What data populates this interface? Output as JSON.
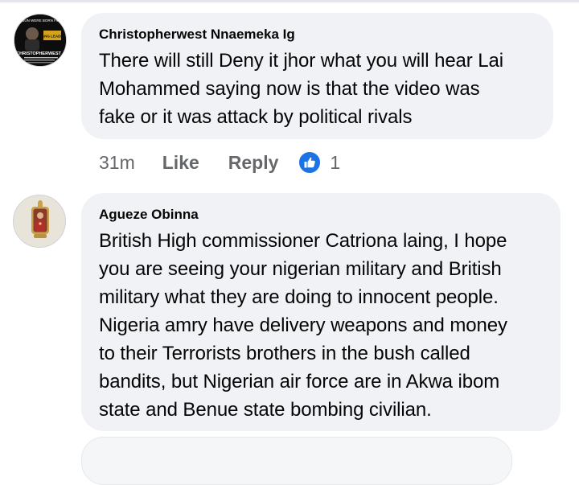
{
  "comments": [
    {
      "author": "Christopherwest Nnaemeka Ig",
      "text": "There will still Deny it jhor what you will hear Lai\nMohammed saying now is that the video was\nfake or it was attack by political rivals",
      "avatar_text": {
        "top": "IT JUN WERE BORN FOR?",
        "badge": "GANG LEADER",
        "name": "CHRISTOPHERWEST"
      },
      "time": "31m",
      "like_label": "Like",
      "reply_label": "Reply",
      "reaction_icon": "thumbs-up-icon",
      "reaction_count": "1"
    },
    {
      "author": "Agueze Obinna",
      "text": "British High commissioner Catriona laing, I hope\nyou are seeing your nigerian military and British\nmilitary what they are doing to innocent people.\nNigeria amry have delivery weapons and money\nto their Terrorists brothers in the bush called\nbandits, but Nigerian air force are in Akwa ibom\nstate and Benue state bombing civilian."
    }
  ],
  "colors": {
    "bubble_bg": "#f0f2f5",
    "meta_text": "#65676b",
    "like_blue": "#1b74e4"
  }
}
